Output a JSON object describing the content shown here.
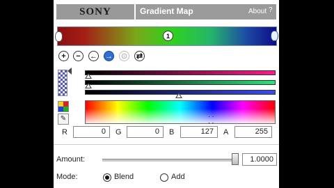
{
  "header": {
    "brand": "SONY",
    "title": "Gradient Map",
    "about_label": "About",
    "help_label": "?"
  },
  "gradient_bar": {
    "stop_label": "1"
  },
  "toolbar": {
    "buttons": [
      {
        "name": "add-stop",
        "glyph": "+"
      },
      {
        "name": "remove-stop",
        "glyph": "−"
      },
      {
        "name": "previous-stop",
        "glyph": "←"
      },
      {
        "name": "next-stop",
        "glyph": "→"
      },
      {
        "name": "link",
        "glyph": "⊙"
      },
      {
        "name": "swap",
        "glyph": "⇄"
      }
    ]
  },
  "color_sliders": {
    "red_level": 0,
    "green_level": 0,
    "blue_level": 127,
    "max": 255
  },
  "fields": {
    "r_label": "R",
    "r_value": "0",
    "g_label": "G",
    "g_value": "0",
    "b_label": "B",
    "b_value": "127",
    "a_label": "A",
    "a_value": "255"
  },
  "amount": {
    "label": "Amount:",
    "value": "1.0000",
    "level": 1.0
  },
  "mode": {
    "label": "Mode:",
    "options": [
      "Blend",
      "Add"
    ],
    "selected": "Blend"
  },
  "colors": {
    "header_gray": "#9b9b9b",
    "active_button": "#2e6fd0"
  }
}
